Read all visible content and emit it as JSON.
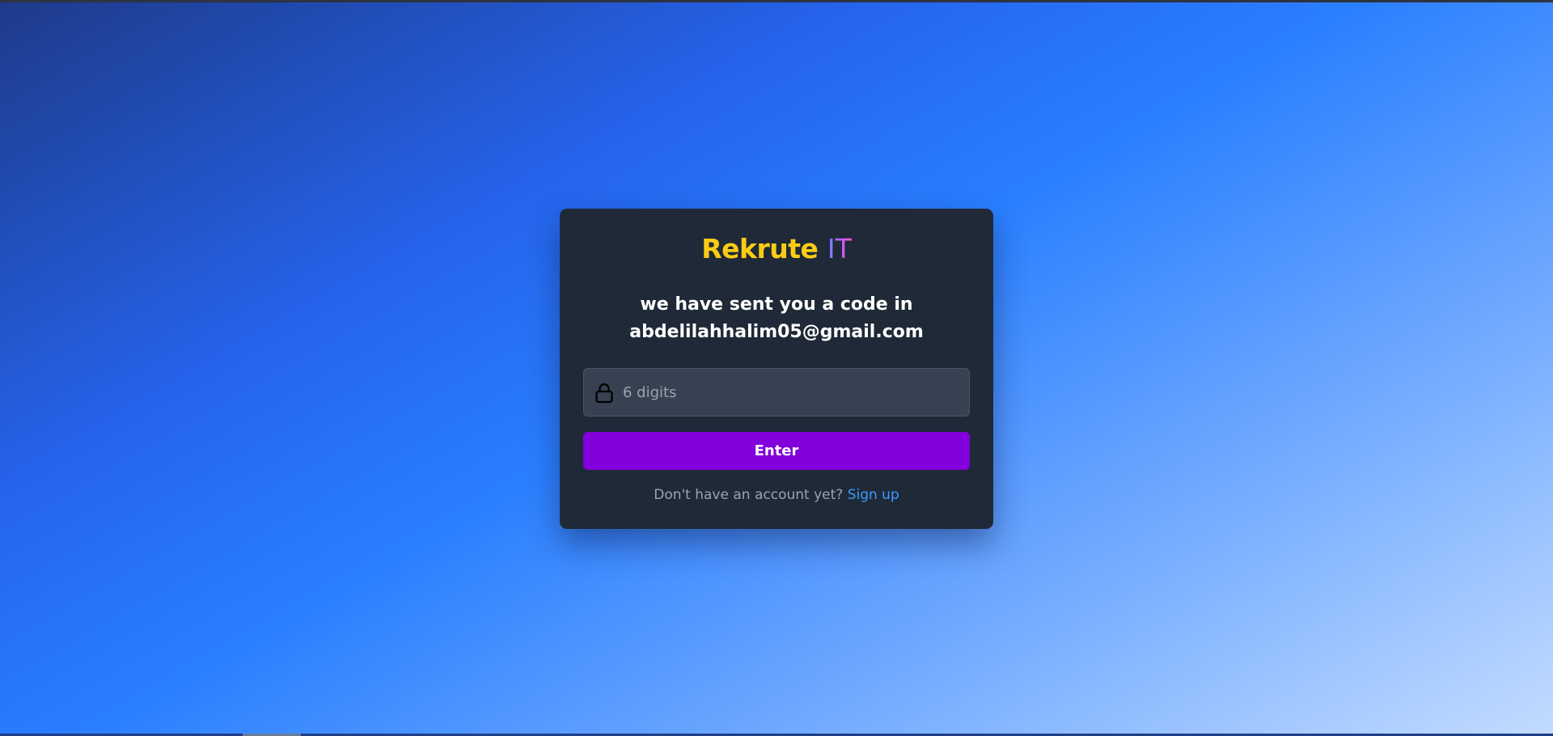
{
  "logo": {
    "brand": "Rekrute",
    "accent": "IT"
  },
  "message": {
    "line1": "we have sent you a code in",
    "email": "abdelilahhalim05@gmail.com"
  },
  "code_input": {
    "placeholder": "6 digits",
    "value": "",
    "icon": "lock-icon"
  },
  "enter_button": {
    "label": "Enter"
  },
  "footer": {
    "prompt": "Don't have an account yet?",
    "link": "Sign up"
  },
  "colors": {
    "brand_yellow": "#facc15",
    "accent_gradient_start": "#6d8cff",
    "accent_gradient_end": "#ff5ec8",
    "card_background": "#1f2937",
    "input_background": "#374151",
    "button_purple": "#8200db",
    "link_blue": "#3b9bff"
  }
}
